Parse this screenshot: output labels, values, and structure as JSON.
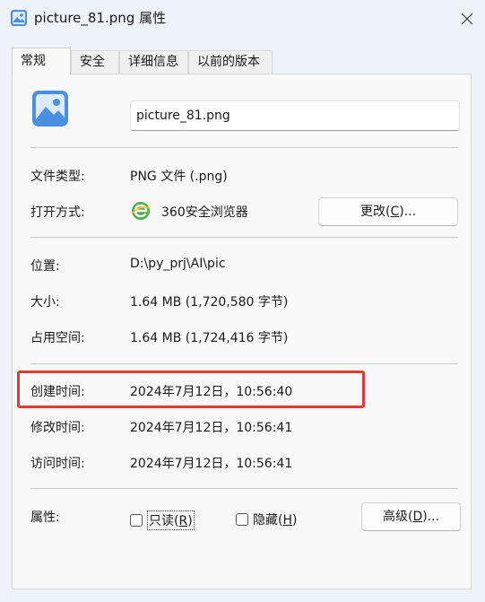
{
  "window": {
    "title": "picture_81.png 属性"
  },
  "tabs": [
    {
      "label": "常规"
    },
    {
      "label": "安全"
    },
    {
      "label": "详细信息"
    },
    {
      "label": "以前的版本"
    }
  ],
  "general": {
    "filename": "picture_81.png",
    "file_type_label": "文件类型:",
    "file_type_value": "PNG 文件 (.png)",
    "open_with_label": "打开方式:",
    "open_with_app": "360安全浏览器",
    "change_button_pre": "更改(",
    "change_button_key": "C",
    "change_button_post": ")...",
    "location_label": "位置:",
    "location_value": "D:\\py_prj\\AI\\pic",
    "size_label": "大小:",
    "size_value": "1.64 MB (1,720,580 字节)",
    "disk_size_label": "占用空间:",
    "disk_size_value": "1.64 MB (1,724,416 字节)",
    "created_label": "创建时间:",
    "created_value": "2024年7月12日，10:56:40",
    "modified_label": "修改时间:",
    "modified_value": "2024年7月12日，10:56:41",
    "accessed_label": "访问时间:",
    "accessed_value": "2024年7月12日，10:56:41",
    "attributes_label": "属性:",
    "readonly_pre": "只读(",
    "readonly_key": "R",
    "readonly_post": ")",
    "readonly_checked": false,
    "hidden_pre": "隐藏(",
    "hidden_key": "H",
    "hidden_post": ")",
    "hidden_checked": false,
    "advanced_pre": "高级(",
    "advanced_key": "D",
    "advanced_post": ")..."
  },
  "colors": {
    "highlight_border": "#e53935",
    "app_icon_green": "#4caf50",
    "image_icon_blue": "#4a90e2"
  }
}
